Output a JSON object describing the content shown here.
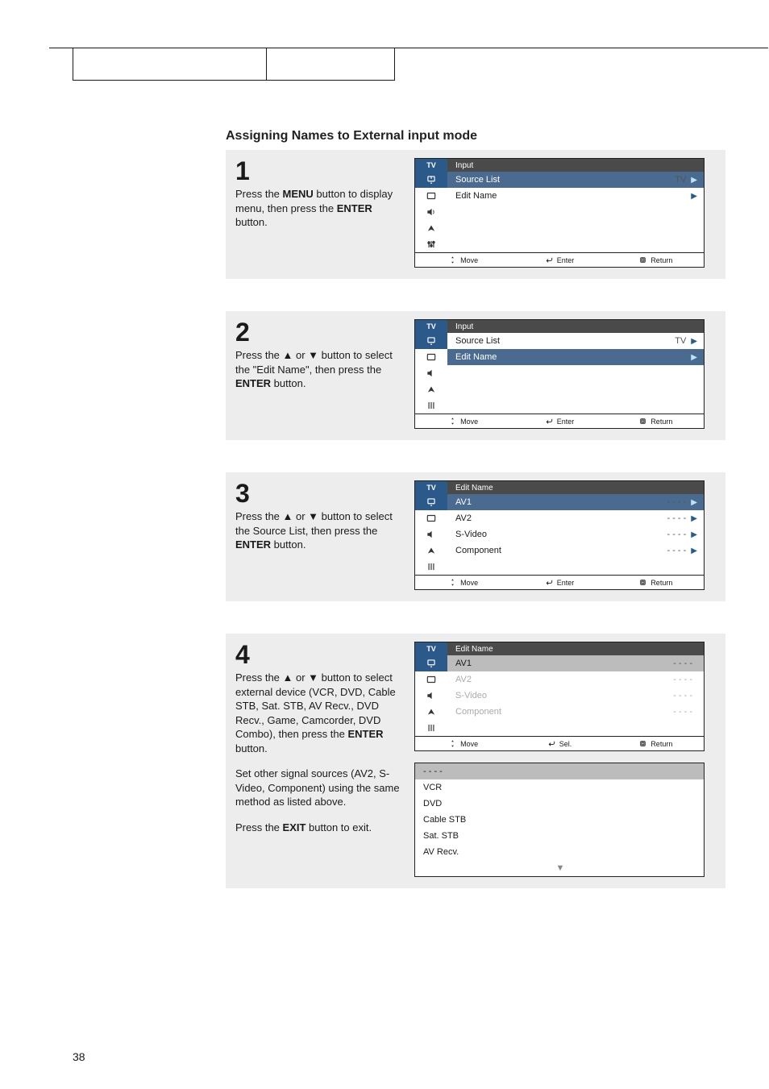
{
  "section_title": "Assigning Names to External input mode",
  "page_number": "38",
  "steps": {
    "s1": {
      "num": "1",
      "t1": "Press the ",
      "b1": "MENU",
      "t2": " button to display menu, then press the ",
      "b2": "ENTER",
      "t3": " button."
    },
    "s2": {
      "num": "2",
      "t1": "Press the ▲ or ▼ button to select the \"Edit Name\", then press the ",
      "b1": "ENTER",
      "t2": " button."
    },
    "s3": {
      "num": "3",
      "t1": "Press the ▲ or ▼ button to select the Source List, then press the ",
      "b1": "ENTER",
      "t2": " button."
    },
    "s4": {
      "num": "4",
      "t1": "Press the ▲ or ▼ button to select external device (VCR, DVD, Cable STB, Sat. STB, AV Recv., DVD Recv., Game, Camcorder, DVD Combo), then press the ",
      "b1": "ENTER",
      "t2": " button.",
      "p2": "Set other signal sources (AV2, S-Video, Component) using the same method as listed above.",
      "p3a": "Press the ",
      "p3b": "EXIT",
      "p3c": " button to exit."
    }
  },
  "tv_label": "TV",
  "footer": {
    "move": "Move",
    "enter": "Enter",
    "return": "Return",
    "sel": "Sel."
  },
  "menu1": {
    "title": "Input",
    "rows": [
      {
        "label": "Source List",
        "val": "TV",
        "sel": true
      },
      {
        "label": "Edit Name",
        "val": ""
      }
    ]
  },
  "menu2": {
    "title": "Input",
    "rows": [
      {
        "label": "Source List",
        "val": "TV"
      },
      {
        "label": "Edit Name",
        "val": "",
        "sel": true
      }
    ]
  },
  "menu3": {
    "title": "Edit Name",
    "rows": [
      {
        "label": "AV1",
        "val": "- - - -",
        "sel": true
      },
      {
        "label": "AV2",
        "val": "- - - -"
      },
      {
        "label": "S-Video",
        "val": "- - - -"
      },
      {
        "label": "Component",
        "val": "- - - -"
      }
    ]
  },
  "menu4": {
    "title": "Edit Name",
    "rows": [
      {
        "label": "AV1",
        "val": "- - - -"
      },
      {
        "label": "AV2",
        "val": "- - - -"
      },
      {
        "label": "S-Video",
        "val": "- - - -"
      },
      {
        "label": "Component",
        "val": "- - - -"
      }
    ]
  },
  "options": [
    "- - - -",
    "VCR",
    "DVD",
    "Cable STB",
    "Sat. STB",
    "AV Recv."
  ],
  "dash": "▼"
}
